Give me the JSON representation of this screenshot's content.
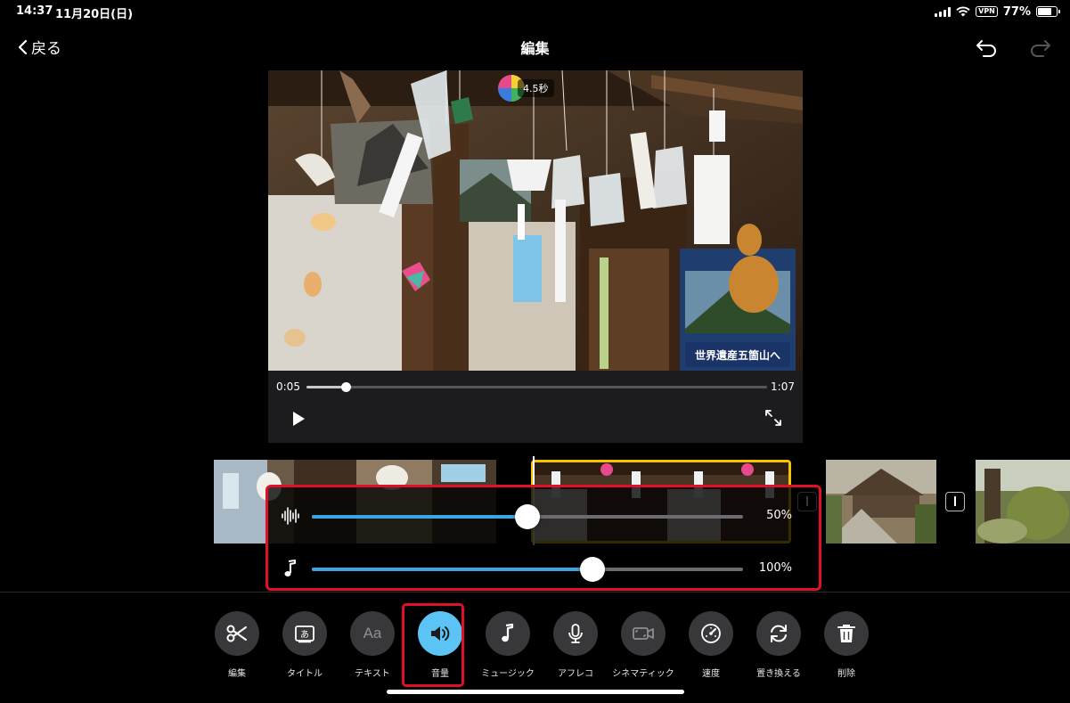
{
  "status_bar": {
    "time": "14:37",
    "date": "11月20日(日)",
    "vpn": "VPN",
    "battery": "77%",
    "battery_level": 0.77
  },
  "nav": {
    "back_label": "戻る",
    "title": "編集"
  },
  "preview": {
    "clip_badge": "4.5秒",
    "poster_text": "世界遺産五箇山へ"
  },
  "player": {
    "current_time": "0:05",
    "total_time": "1:07",
    "progress": 0.085
  },
  "volume": {
    "clip_volume_label": "50%",
    "clip_volume": 0.5,
    "music_volume_label": "100%",
    "music_volume": 0.65
  },
  "toolbar": {
    "tools": [
      {
        "label": "編集",
        "icon": "scissors-icon"
      },
      {
        "label": "タイトル",
        "icon": "title-icon"
      },
      {
        "label": "テキスト",
        "icon": "text-icon",
        "glyph": "Aa"
      },
      {
        "label": "音量",
        "icon": "speaker-icon",
        "active": true
      },
      {
        "label": "ミュージック",
        "icon": "music-note-icon"
      },
      {
        "label": "アフレコ",
        "icon": "microphone-icon"
      },
      {
        "label": "シネマティック",
        "icon": "cinematic-camera-icon"
      },
      {
        "label": "速度",
        "icon": "speedometer-icon"
      },
      {
        "label": "置き換える",
        "icon": "replace-icon"
      },
      {
        "label": "削除",
        "icon": "trash-icon"
      }
    ]
  },
  "colors": {
    "accent": "#3aa6e2",
    "active_tool": "#5cc3f5",
    "highlight_red": "#e0102a",
    "selected_clip": "#f5c400"
  }
}
